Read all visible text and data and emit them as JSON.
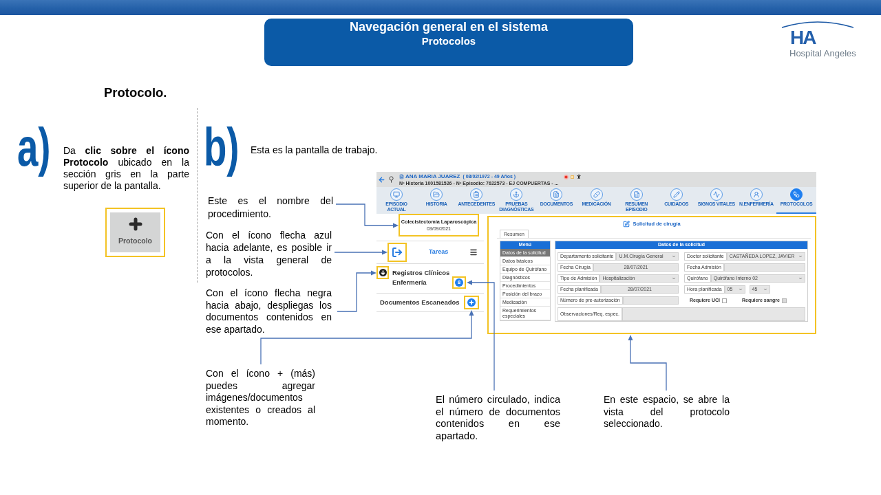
{
  "header": {
    "title": "Navegación general en el sistema",
    "subtitle": "Protocolos"
  },
  "logo": {
    "mark": "HA",
    "name": "Hospital Angeles"
  },
  "section_title": "Protocolo.",
  "steps": [
    {
      "letter": "a)",
      "text": "Da **clic sobre el ícono Protocolo** ubicado en la sección gris en la parte superior de la pantalla.",
      "button_label": "Protocolo"
    },
    {
      "letter": "b)",
      "text": "Esta es la pantalla de trabajo."
    }
  ],
  "callouts": [
    "Este es el nombre del procedimiento.",
    "Con el ícono flecha azul hacia adelante, es posible ir a la vista general de protocolos.",
    "Con el ícono flecha negra hacia abajo, despliegas los documentos contenidos en ese apartado.",
    "Con el ícono + (más) puedes agregar imágenes/documentos existentes o creados al momento.",
    "El número circulado, indica el número de documentos contenidos en ese apartado.",
    "En este espacio, se abre la vista del protocolo seleccionado."
  ],
  "app_screenshot": {
    "patient": {
      "name": "ANA MARIA JUAREZ",
      "birth": "( 08/02/1972 - 49 Años )",
      "details": "Nº Historia 1001581526 - Nº Episodio: 7622573 - EJ COMPUERTAS - ..."
    },
    "nav_items": [
      {
        "label": "EPISODIO ACTUAL",
        "selected": false
      },
      {
        "label": "HISTORIA",
        "selected": false
      },
      {
        "label": "ANTECEDENTES",
        "selected": false
      },
      {
        "label": "PRUEBAS DIAGNÓSTICAS",
        "selected": false
      },
      {
        "label": "DOCUMENTOS",
        "selected": false
      },
      {
        "label": "MEDICACIÓN",
        "selected": false
      },
      {
        "label": "RESUMEN EPISODIO",
        "selected": false
      },
      {
        "label": "CUIDADOS",
        "selected": false
      },
      {
        "label": "SIGNOS VITALES",
        "selected": false
      },
      {
        "label": "N.ENFERMERÍA",
        "selected": false
      },
      {
        "label": "PROTOCOLOS",
        "selected": true
      }
    ],
    "procedure": {
      "name": "Colecistectomía Laparoscópica",
      "date": "03/09/2021"
    },
    "tasks_label": "Tareas",
    "sections": [
      {
        "kind": "expandable",
        "label": "Registros Clínicos Enfermería",
        "count": "8"
      },
      {
        "kind": "addable",
        "label": "Documentos Escaneados"
      }
    ],
    "form": {
      "title": "Solicitud de cirugía",
      "tabs": [
        {
          "label": "Resumen",
          "selected": true
        }
      ],
      "menu": {
        "title": "Menú",
        "items": [
          {
            "label": "Datos de la solicitud",
            "selected": true
          },
          {
            "label": "Datos básicos",
            "selected": false
          },
          {
            "label": "Equipo de Quirófano",
            "selected": false
          },
          {
            "label": "Diagnósticos",
            "selected": false
          },
          {
            "label": "Procedimientos",
            "selected": false
          },
          {
            "label": "Posición del brazo",
            "selected": false
          },
          {
            "label": "Medicación",
            "selected": false
          },
          {
            "label": "Requerimientos especiales",
            "selected": false
          }
        ]
      },
      "panel_title": "Datos de la solicitud",
      "fields": [
        {
          "kind": "select",
          "label": "Departamento solicitante",
          "value": "U.M.Cirugía General"
        },
        {
          "kind": "select",
          "label": "Doctor solicitante",
          "value": "CASTAÑEDA LOPEZ, JAVIER"
        },
        {
          "kind": "date",
          "label": "Fecha Cirugía",
          "value": "28/07/2021"
        },
        {
          "kind": "date",
          "label": "Fecha Admisión"
        },
        {
          "kind": "select",
          "label": "Tipo de Admisión",
          "value": "Hospitalización"
        },
        {
          "kind": "select",
          "label": "Quirófano",
          "value": "Quirófano Interno 02"
        },
        {
          "kind": "date",
          "label": "Fecha planificada",
          "value": "28/07/2021"
        },
        {
          "kind": "time",
          "label": "Hora planificada",
          "hour": "05",
          "minute": "45"
        },
        {
          "kind": "text",
          "label": "Número de pre-autorización"
        },
        {
          "kind": "checkboxes",
          "items": [
            {
              "label": "Requiere UCI",
              "checked": false,
              "disabled": false
            },
            {
              "label": "Requiere sangre",
              "checked": false,
              "disabled": true
            }
          ]
        },
        {
          "kind": "textarea",
          "label": "Observaciones/Req. espec."
        }
      ]
    }
  }
}
